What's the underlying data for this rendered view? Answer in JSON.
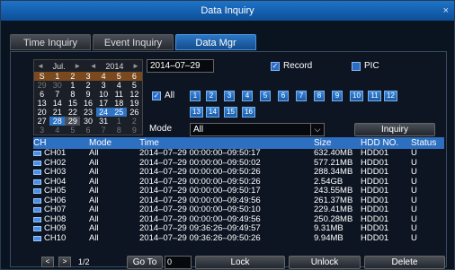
{
  "window": {
    "title": "Data Inquiry",
    "close_glyph": "×"
  },
  "tabs": [
    {
      "label": "Time Inquiry",
      "active": false
    },
    {
      "label": "Event Inquiry",
      "active": false
    },
    {
      "label": "Data Mgr",
      "active": true
    }
  ],
  "calendar": {
    "month": "Jul.",
    "year": "2014",
    "weekdays": [
      "S",
      "1",
      "2",
      "3",
      "4",
      "5",
      "6"
    ],
    "weeks": [
      [
        "29",
        "30",
        "1",
        "2",
        "3",
        "4",
        "5"
      ],
      [
        "6",
        "7",
        "8",
        "9",
        "10",
        "11",
        "12"
      ],
      [
        "13",
        "14",
        "15",
        "16",
        "17",
        "18",
        "19"
      ],
      [
        "20",
        "21",
        "22",
        "23",
        "24",
        "25",
        "26"
      ],
      [
        "27",
        "28",
        "29",
        "30",
        "31",
        "1",
        "2"
      ],
      [
        "3",
        "4",
        "5",
        "6",
        "7",
        "8",
        "9"
      ]
    ]
  },
  "date_value": "2014–07–29",
  "record": {
    "label": "Record",
    "checked": true
  },
  "pic": {
    "label": "PIC",
    "checked": false
  },
  "all_channels": {
    "label": "All",
    "checked": true
  },
  "channels": [
    "1",
    "2",
    "3",
    "4",
    "5",
    "6",
    "7",
    "8",
    "9",
    "10",
    "11",
    "12",
    "13",
    "14",
    "15",
    "16"
  ],
  "mode": {
    "label": "Mode",
    "value": "All"
  },
  "inquiry_label": "Inquiry",
  "table": {
    "headers": {
      "ch": "CH",
      "mode": "Mode",
      "time": "Time",
      "size": "Size",
      "hdd": "HDD NO.",
      "status": "Status"
    },
    "rows": [
      {
        "ch": "CH01",
        "mode": "All",
        "time": "2014–07–29 00:00:00–09:50:17",
        "size": "632.40MB",
        "hdd": "HDD01",
        "status": "U"
      },
      {
        "ch": "CH02",
        "mode": "All",
        "time": "2014–07–29 00:00:00–09:50:02",
        "size": "577.21MB",
        "hdd": "HDD01",
        "status": "U"
      },
      {
        "ch": "CH03",
        "mode": "All",
        "time": "2014–07–29 00:00:00–09:50:26",
        "size": "288.34MB",
        "hdd": "HDD01",
        "status": "U"
      },
      {
        "ch": "CH04",
        "mode": "All",
        "time": "2014–07–29 00:00:00–09:50:26",
        "size": "2.54GB",
        "hdd": "HDD01",
        "status": "U"
      },
      {
        "ch": "CH05",
        "mode": "All",
        "time": "2014–07–29 00:00:00–09:50:17",
        "size": "243.55MB",
        "hdd": "HDD01",
        "status": "U"
      },
      {
        "ch": "CH06",
        "mode": "All",
        "time": "2014–07–29 00:00:00–09:49:56",
        "size": "261.37MB",
        "hdd": "HDD01",
        "status": "U"
      },
      {
        "ch": "CH07",
        "mode": "All",
        "time": "2014–07–29 00:00:00–09:50:10",
        "size": "229.41MB",
        "hdd": "HDD01",
        "status": "U"
      },
      {
        "ch": "CH08",
        "mode": "All",
        "time": "2014–07–29 00:00:00–09:49:56",
        "size": "250.28MB",
        "hdd": "HDD01",
        "status": "U"
      },
      {
        "ch": "CH09",
        "mode": "All",
        "time": "2014–07–29 09:36:26–09:49:57",
        "size": "9.31MB",
        "hdd": "HDD01",
        "status": "U"
      },
      {
        "ch": "CH10",
        "mode": "All",
        "time": "2014–07–29 09:36:26–09:50:26",
        "size": "9.94MB",
        "hdd": "HDD01",
        "status": "U"
      }
    ]
  },
  "footer": {
    "prev_glyph": "<",
    "next_glyph": ">",
    "page": "1/2",
    "goto_label": "Go To",
    "goto_value": "0",
    "lock_label": "Lock",
    "unlock_label": "Unlock",
    "delete_label": "Delete"
  }
}
